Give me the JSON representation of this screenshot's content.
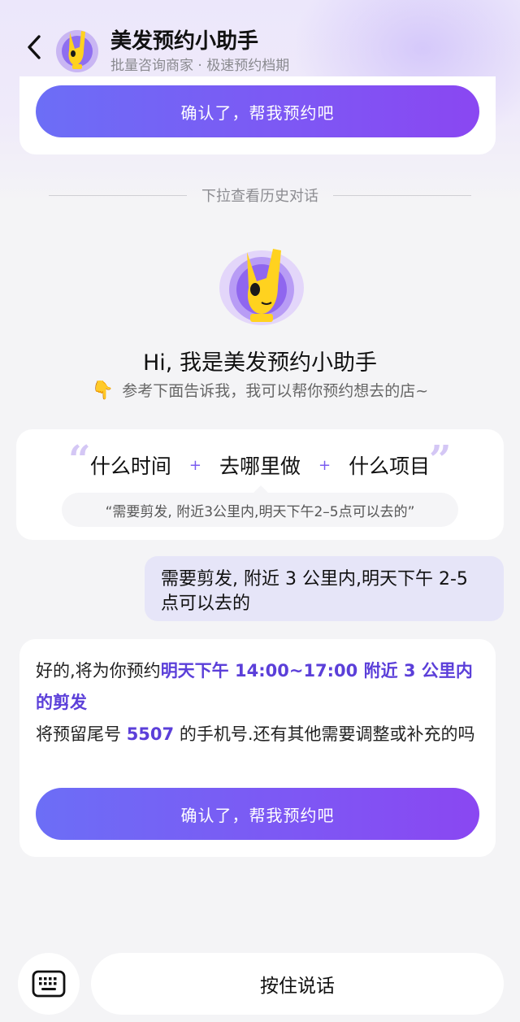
{
  "header": {
    "title": "美发预约小助手",
    "subtitle": "批量咨询商家 · 极速预约档期"
  },
  "top_card": {
    "confirm_label": "确认了，帮我预约吧"
  },
  "history_divider": "下拉查看历史对话",
  "greeting": {
    "title": "Hi, 我是美发预约小助手",
    "hint_icon": "👇",
    "hint": "参考下面告诉我，我可以帮你预约想去的店~"
  },
  "guide": {
    "items": [
      "什么时间",
      "去哪里做",
      "什么项目"
    ],
    "plus": "+",
    "example": "“需要剪发, 附近3公里内,明天下午2–5点可以去的”"
  },
  "user_message": "需要剪发, 附近 3 公里内,明天下午 2-5 点可以去的",
  "reply": {
    "line1_prefix": "好的,将为你预约",
    "line1_highlight": "明天下午 14:00~17:00 附近 3 公里内的剪发",
    "line2_prefix": "将预留尾号 ",
    "phone_tail": "5507",
    "line2_suffix": " 的手机号.还有其他需要调整或补充的吗",
    "confirm_label": "确认了，帮我预约吧"
  },
  "bottom_bar": {
    "voice_label": "按住说话",
    "keyboard_icon": "keyboard-icon"
  },
  "colors": {
    "accent": "#5b3fd9",
    "button_gradient_start": "#6c6ef6",
    "button_gradient_end": "#8a47f2",
    "user_bubble": "#e6e5f8"
  }
}
